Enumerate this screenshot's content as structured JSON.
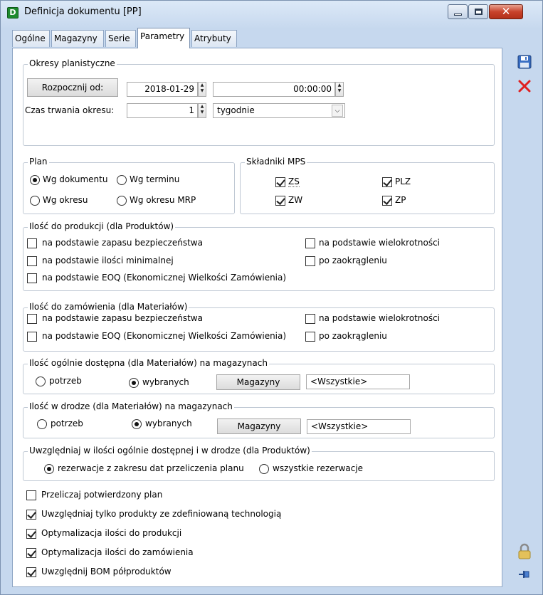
{
  "window": {
    "title": "Definicja dokumentu [PP]",
    "icon_letter": "D"
  },
  "tabs": [
    {
      "label": "Ogólne"
    },
    {
      "label": "Magazyny"
    },
    {
      "label": "Serie"
    },
    {
      "label": "Parametry"
    },
    {
      "label": "Atrybuty"
    }
  ],
  "okresy": {
    "legend": "Okresy planistyczne",
    "start_button": "Rozpocznij od:",
    "date_value": "2018-01-29",
    "time_value": "00:00:00",
    "duration_label": "Czas trwania okresu:",
    "duration_value": "1",
    "unit_value": "tygodnie"
  },
  "plan": {
    "legend": "Plan",
    "options": [
      "Wg dokumentu",
      "Wg terminu",
      "Wg okresu",
      "Wg okresu MRP"
    ],
    "selected": "Wg dokumentu"
  },
  "mps": {
    "legend": "Składniki MPS",
    "items": [
      {
        "label": "ZS",
        "checked": true
      },
      {
        "label": "PLZ",
        "checked": true
      },
      {
        "label": "ZW",
        "checked": true
      },
      {
        "label": "ZP",
        "checked": true
      }
    ]
  },
  "produkcja": {
    "legend": "Ilość do produkcji (dla Produktów)",
    "items": [
      {
        "label": "na podstawie zapasu bezpieczeństwa",
        "checked": false
      },
      {
        "label": "na podstawie ilości minimalnej",
        "checked": false
      },
      {
        "label": "na podstawie EOQ (Ekonomicznej Wielkości Zamówienia)",
        "checked": false
      },
      {
        "label": "na podstawie wielokrotności",
        "checked": false
      },
      {
        "label": "po zaokrągleniu",
        "checked": false
      }
    ]
  },
  "zamowienie": {
    "legend": "Ilość do zamówienia (dla Materiałów)",
    "items": [
      {
        "label": "na podstawie zapasu bezpieczeństwa",
        "checked": false
      },
      {
        "label": "na podstawie EOQ (Ekonomicznej Wielkości Zamówienia)",
        "checked": false
      },
      {
        "label": "na podstawie wielokrotności",
        "checked": false
      },
      {
        "label": "po zaokrągleniu",
        "checked": false
      }
    ]
  },
  "dostepna": {
    "legend": "Ilość ogólnie dostępna (dla Materiałów) na magazynach",
    "option_potrzeb": "potrzeb",
    "option_wybranych": "wybranych",
    "selected": "wybranych",
    "button": "Magazyny",
    "value": "<Wszystkie>"
  },
  "drodze": {
    "legend": "Ilość w drodze (dla Materiałów) na magazynach",
    "option_potrzeb": "potrzeb",
    "option_wybranych": "wybranych",
    "selected": "wybranych",
    "button": "Magazyny",
    "value": "<Wszystkie>"
  },
  "uwzgledniaj": {
    "legend": "Uwzględniaj w ilości ogólnie dostępnej i w drodze (dla Produktów)",
    "option_zakres": "rezerwacje z zakresu dat przeliczenia planu",
    "option_wszystkie": "wszystkie rezerwacje",
    "selected": "rezerwacje z zakresu dat przeliczenia planu"
  },
  "bottom_checks": [
    {
      "label": "Przeliczaj potwierdzony plan",
      "checked": false
    },
    {
      "label": "Uwzględniaj tylko produkty ze zdefiniowaną technologią",
      "checked": true
    },
    {
      "label": "Optymalizacja ilości do produkcji",
      "checked": true
    },
    {
      "label": "Optymalizacja ilości do zamówienia",
      "checked": true
    },
    {
      "label": "Uwzględnij BOM półproduktów",
      "checked": true
    }
  ],
  "colors": {
    "title_bg": "#c6d8ee",
    "close_red": "#c8432c",
    "cancel_red": "#e02020",
    "save_blue": "#3a6fc4"
  }
}
